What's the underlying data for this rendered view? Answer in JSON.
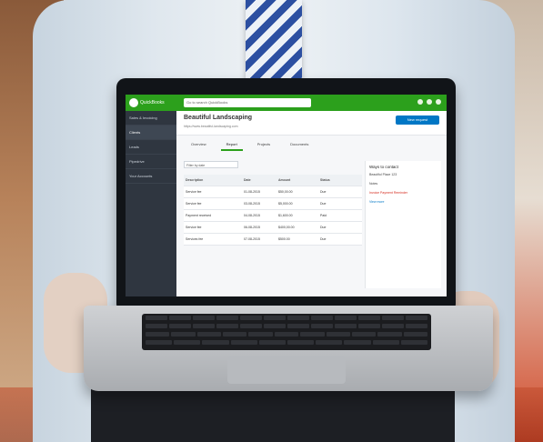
{
  "app": {
    "brand": "QuickBooks",
    "search_placeholder": "Go to search QuickBooks"
  },
  "sidebar": {
    "items": [
      {
        "label": "Sales & Invoicing"
      },
      {
        "label": "Clients"
      },
      {
        "label": "Leads"
      },
      {
        "label": "Pipedrive"
      },
      {
        "label": "Your Accounts"
      }
    ]
  },
  "header": {
    "client_name": "Beautiful Landscaping",
    "link_text": "https://www.beautiful-landscaping.com",
    "new_button": "New request"
  },
  "tabs": [
    {
      "label": "Overview"
    },
    {
      "label": "Report"
    },
    {
      "label": "Projects"
    },
    {
      "label": "Documents"
    }
  ],
  "filter": {
    "label": "Filter by date"
  },
  "table": {
    "headers": [
      "Description",
      "Date",
      "Amount",
      "Status"
    ],
    "rows": [
      [
        "Service fee",
        "01-08-2015",
        "$50,00.00",
        "Due"
      ],
      [
        "Service fee",
        "03-08-2015",
        "$5,000.00",
        "Due"
      ],
      [
        "Payment received",
        "04-08-2015",
        "$1,600.00",
        "Paid"
      ],
      [
        "Service fee",
        "06-08-2015",
        "$400,00.00",
        "Due"
      ],
      [
        "Services fee",
        "07-08-2015",
        "$500.00",
        "Due"
      ]
    ]
  },
  "side_panel": {
    "title": "Ways to contact",
    "address": "Beautiful Place 123",
    "notes_label": "Notes",
    "alert": "Invoice Payment Reminder",
    "more_link": "View more"
  },
  "colors": {
    "appbar": "#2ca01c",
    "sidebar": "#2f3640",
    "primary_button": "#0077c5",
    "alert": "#d52b1e"
  }
}
